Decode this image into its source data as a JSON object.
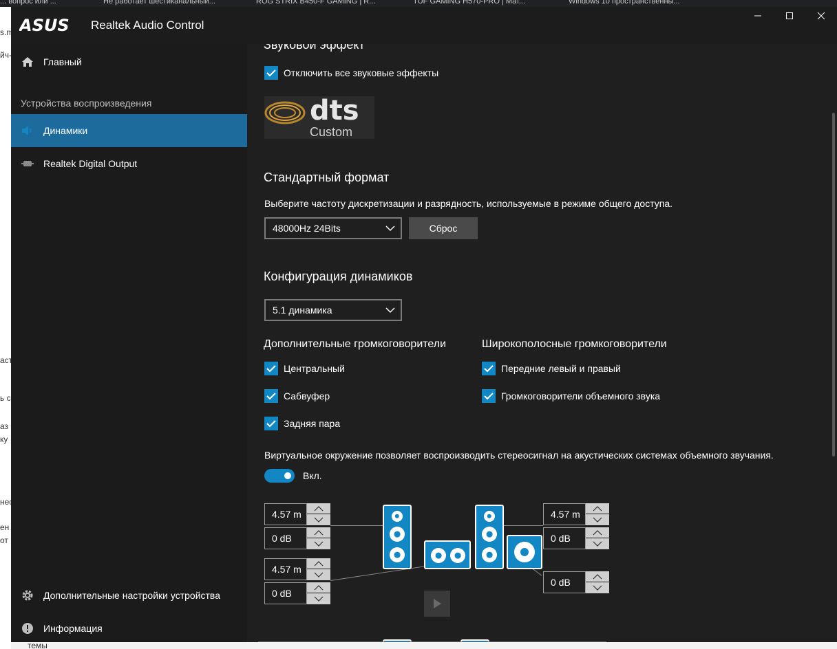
{
  "background": {
    "tabs": [
      "... вопрос или ...",
      "Не работает шестиканальный...",
      "ROG STRIX B450-F GAMING | R...",
      "TUF GAMING H570-PRO | Мат...",
      "Windows 10 пространственны..."
    ],
    "left_fragments": [
      "s.m",
      "йч-",
      "аст",
      "ь сі",
      "аз",
      "ку",
      "нес",
      "ен",
      "от"
    ],
    "bottom_fragment": "темы"
  },
  "window": {
    "brand": "ASUS",
    "title": "Realtek Audio Control",
    "minimize": "—",
    "maximize": "☐",
    "close": "✕"
  },
  "sidebar": {
    "main_label": "Главный",
    "section_label": "Устройства воспроизведения",
    "devices": [
      {
        "label": "Динамики",
        "active": true
      },
      {
        "label": "Realtek Digital Output",
        "active": false
      }
    ],
    "advanced_label": "Дополнительные настройки устройства",
    "info_label": "Информация"
  },
  "content": {
    "effects_heading": "Звуковой эффект",
    "disable_effects_label": "Отключить все звуковые эффекты",
    "dts_text": "dts",
    "dts_sub": "Custom",
    "format_heading": "Стандартный формат",
    "format_desc": "Выберите частоту дискретизации и разрядность, используемые в режиме общего доступа.",
    "format_value": "48000Hz 24Bits",
    "reset_label": "Сброс",
    "speaker_heading": "Конфигурация динамиков",
    "speaker_value": "5.1 динамика",
    "optional_heading": "Дополнительные громкоговорители",
    "optional_items": [
      "Центральный",
      "Сабвуфер",
      "Задняя пара"
    ],
    "fullrange_heading": "Широкополосные громкоговорители",
    "fullrange_items": [
      "Передние левый и правый",
      "Громкоговорители объемного звука"
    ],
    "virtual_desc": "Виртуальное окружение позволяет воспроизводить стереосигнал на акустических системах объемного звучания.",
    "toggle_label": "Вкл.",
    "toggle_on": true,
    "spinners": {
      "fl_distance": "4.57 m",
      "fl_gain": "0 dB",
      "c_distance": "4.57 m",
      "c_gain": "0 dB",
      "fr_distance": "4.57 m",
      "fr_gain": "0 dB",
      "sub_gain": "0 dB"
    }
  },
  "colors": {
    "accent": "#1287c4",
    "active_nav": "#1d6a9d",
    "window_bg": "#1f1f1f",
    "sidebar_bg": "#1b1b1b"
  }
}
